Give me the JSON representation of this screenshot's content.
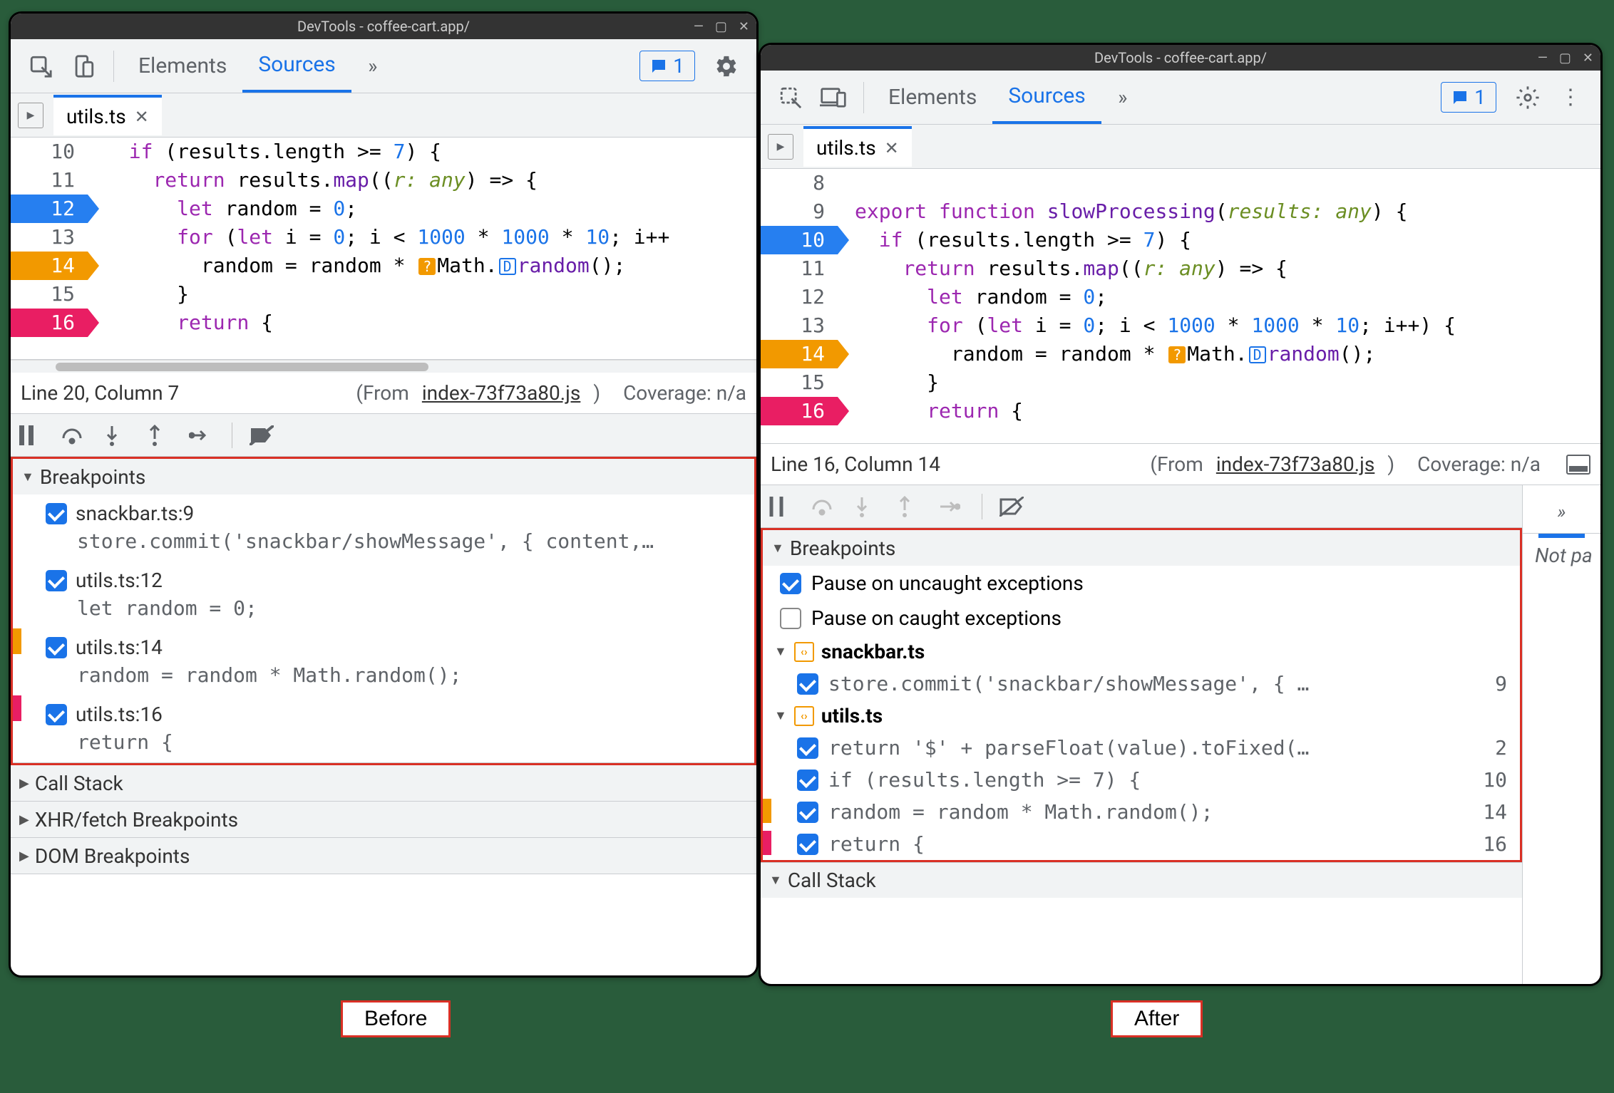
{
  "os_title": "DevTools - coffee-cart.app/",
  "tabs": {
    "elements": "Elements",
    "sources": "Sources"
  },
  "issues_count": "1",
  "file_tab": "utils.ts",
  "before": {
    "code": [
      {
        "n": "10",
        "bp": "",
        "txt": [
          "  ",
          [
            "kw",
            "if"
          ],
          " (results.length >= ",
          [
            "num",
            "7"
          ],
          ") {"
        ]
      },
      {
        "n": "11",
        "bp": "",
        "txt": [
          "    ",
          [
            "kw",
            "return"
          ],
          " results.",
          [
            "fn",
            "map"
          ],
          "((",
          [
            "type",
            "r: any"
          ],
          ") => {"
        ]
      },
      {
        "n": "12",
        "bp": "blue",
        "txt": [
          "      ",
          [
            "kw",
            "let"
          ],
          " random = ",
          [
            "num",
            "0"
          ],
          ";"
        ]
      },
      {
        "n": "13",
        "bp": "",
        "txt": [
          "      ",
          [
            "kw",
            "for"
          ],
          " (",
          [
            "kw",
            "let"
          ],
          " i = ",
          [
            "num",
            "0"
          ],
          "; i < ",
          [
            "num",
            "1000"
          ],
          " * ",
          [
            "num",
            "1000"
          ],
          " * ",
          [
            "num",
            "10"
          ],
          "; i++"
        ]
      },
      {
        "n": "14",
        "bp": "orange",
        "txt": [
          "        random = random * ",
          [
            "ib-o",
            "?"
          ],
          "Math.",
          [
            "ib-b",
            "D"
          ],
          [
            "fn",
            "random"
          ],
          "();"
        ]
      },
      {
        "n": "15",
        "bp": "",
        "txt": [
          "      }"
        ]
      },
      {
        "n": "16",
        "bp": "pink",
        "txt": [
          "      ",
          [
            "kw",
            "return"
          ],
          " {"
        ]
      }
    ],
    "status": {
      "linecol": "Line 20, Column 7",
      "fromlabel": "(From ",
      "fromfile": "index-73f73a80.js",
      "from_close": ")",
      "coverage": "Coverage: n/a"
    },
    "panes": {
      "breakpoints_title": "Breakpoints",
      "items": [
        {
          "file": "snackbar.ts:9",
          "code": "store.commit('snackbar/showMessage', { content,…",
          "strip": ""
        },
        {
          "file": "utils.ts:12",
          "code": "let random = 0;",
          "strip": ""
        },
        {
          "file": "utils.ts:14",
          "code": "random = random * Math.random();",
          "strip": "#f29900"
        },
        {
          "file": "utils.ts:16",
          "code": "return {",
          "strip": "#e91e63"
        }
      ],
      "callstack": "Call Stack",
      "xhr": "XHR/fetch Breakpoints",
      "dom": "DOM Breakpoints"
    }
  },
  "after": {
    "code": [
      {
        "n": "8",
        "bp": "",
        "txt": [
          " "
        ]
      },
      {
        "n": "9",
        "bp": "",
        "txt": [
          [
            "export",
            "export"
          ],
          " ",
          [
            "kw",
            "function"
          ],
          " ",
          [
            "fn",
            "slowProcessing"
          ],
          "(",
          [
            "type",
            "results: any"
          ],
          ") {"
        ]
      },
      {
        "n": "10",
        "bp": "blue",
        "txt": [
          "  ",
          [
            "kw",
            "if"
          ],
          " (results.length >= ",
          [
            "num",
            "7"
          ],
          ") {"
        ]
      },
      {
        "n": "11",
        "bp": "",
        "txt": [
          "    ",
          [
            "kw",
            "return"
          ],
          " results.",
          [
            "fn",
            "map"
          ],
          "((",
          [
            "type",
            "r: any"
          ],
          ") => {"
        ]
      },
      {
        "n": "12",
        "bp": "",
        "txt": [
          "      ",
          [
            "kw",
            "let"
          ],
          " random = ",
          [
            "num",
            "0"
          ],
          ";"
        ]
      },
      {
        "n": "13",
        "bp": "",
        "txt": [
          "      ",
          [
            "kw",
            "for"
          ],
          " (",
          [
            "kw",
            "let"
          ],
          " i = ",
          [
            "num",
            "0"
          ],
          "; i < ",
          [
            "num",
            "1000"
          ],
          " * ",
          [
            "num",
            "1000"
          ],
          " * ",
          [
            "num",
            "10"
          ],
          "; i++) {"
        ]
      },
      {
        "n": "14",
        "bp": "orange",
        "txt": [
          "        random = random * ",
          [
            "ib-o",
            "?"
          ],
          "Math.",
          [
            "ib-b",
            "D"
          ],
          [
            "fn",
            "random"
          ],
          "();"
        ]
      },
      {
        "n": "15",
        "bp": "",
        "txt": [
          "      }"
        ]
      },
      {
        "n": "16",
        "bp": "pink",
        "txt": [
          "      ",
          [
            "kw",
            "return"
          ],
          " {"
        ]
      }
    ],
    "status": {
      "linecol": "Line 16, Column 14",
      "fromlabel": "(From ",
      "fromfile": "index-73f73a80.js",
      "from_close": ")",
      "coverage": "Coverage: n/a"
    },
    "panes": {
      "breakpoints_title": "Breakpoints",
      "pause_uncaught": "Pause on uncaught exceptions",
      "pause_caught": "Pause on caught exceptions",
      "groups": [
        {
          "file": "snackbar.ts",
          "items": [
            {
              "code": "store.commit('snackbar/showMessage', { …",
              "ln": "9",
              "strip": ""
            }
          ]
        },
        {
          "file": "utils.ts",
          "items": [
            {
              "code": "return '$' + parseFloat(value).toFixed(…",
              "ln": "2",
              "strip": ""
            },
            {
              "code": "if (results.length >= 7) {",
              "ln": "10",
              "strip": ""
            },
            {
              "code": "random = random * Math.random();",
              "ln": "14",
              "strip": "#f29900"
            },
            {
              "code": "return {",
              "ln": "16",
              "strip": "#e91e63"
            }
          ]
        }
      ],
      "callstack": "Call Stack",
      "notpaused": "Not pa"
    }
  },
  "labels": {
    "before": "Before",
    "after": "After"
  }
}
